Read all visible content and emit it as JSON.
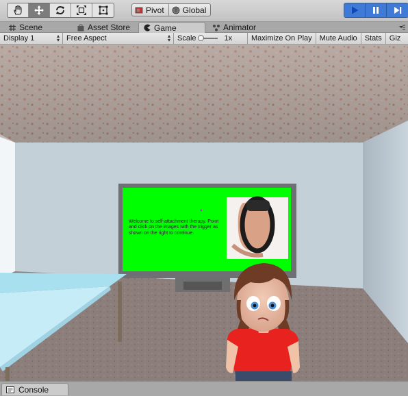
{
  "toolbar": {
    "tools": [
      {
        "name": "hand-tool",
        "icon": "hand-icon"
      },
      {
        "name": "move-tool",
        "icon": "move-icon"
      },
      {
        "name": "rotate-tool",
        "icon": "rotate-icon"
      },
      {
        "name": "scale-tool",
        "icon": "scale-icon"
      },
      {
        "name": "rect-tool",
        "icon": "rect-icon"
      }
    ],
    "pivot_label": "Pivot",
    "global_label": "Global",
    "play_icon": "play-icon",
    "pause_icon": "pause-icon",
    "step_icon": "step-icon",
    "play_color": "#3e7ad6"
  },
  "tabs": {
    "scene": "Scene",
    "asset_store": "Asset Store",
    "game": "Game",
    "animator": "Animator"
  },
  "game_bar": {
    "display": "Display 1",
    "aspect": "Free Aspect",
    "scale_label": "Scale",
    "scale_value": "1x",
    "maximize": "Maximize On Play",
    "mute": "Mute Audio",
    "stats": "Stats",
    "gizmos": "Giz"
  },
  "scene": {
    "tv_message": "Welcome to self-attachment therapy. Point and click on the images with the trigger as shown on the right to continue.",
    "screen_color": "#00ff00",
    "wall_color": "#c4d0d8",
    "floor_color": "#8a7d7a",
    "shirt_color": "#e8221f"
  },
  "console": {
    "label": "Console"
  }
}
